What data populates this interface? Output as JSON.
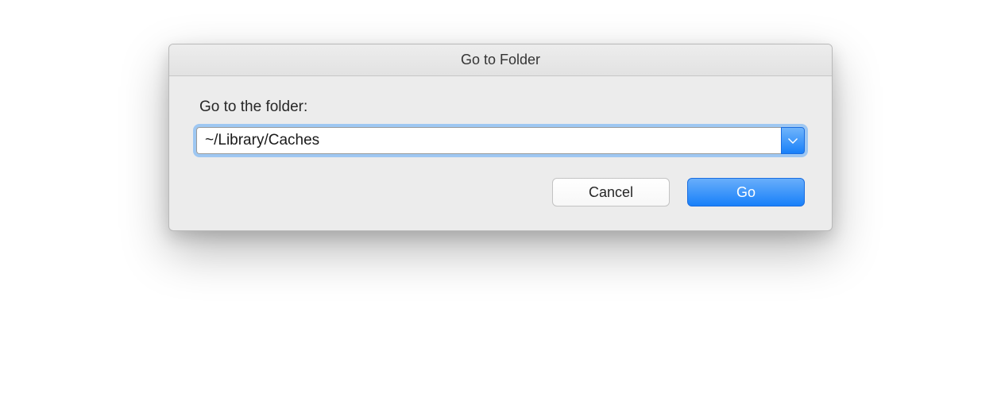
{
  "dialog": {
    "title": "Go to Folder",
    "label": "Go to the folder:",
    "path_value": "~/Library/Caches",
    "cancel_label": "Cancel",
    "go_label": "Go"
  }
}
